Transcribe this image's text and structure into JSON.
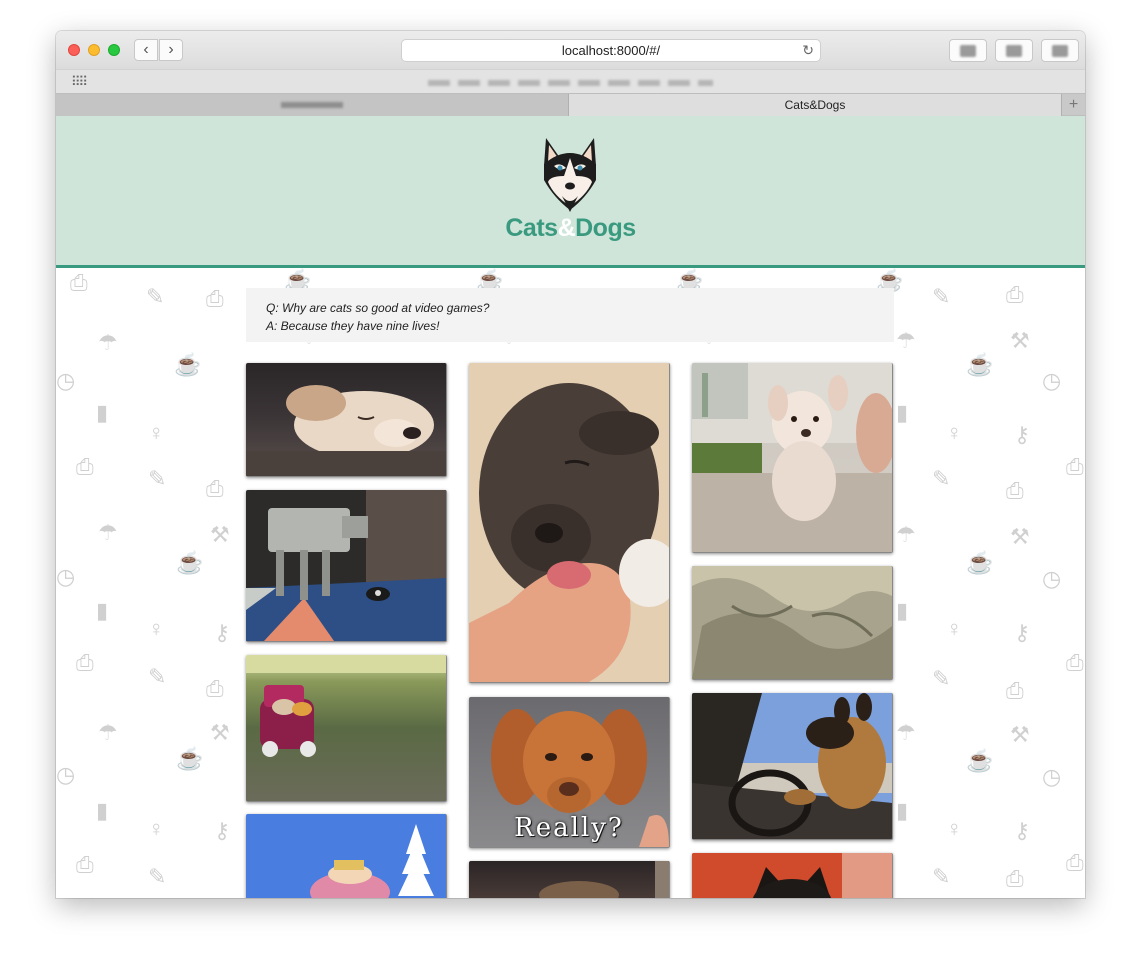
{
  "browser": {
    "url": "localhost:8000/#/",
    "tabs": [
      {
        "label": ""
      },
      {
        "label": "Cats&Dogs"
      }
    ],
    "new_tab_label": "+",
    "back_glyph": "‹",
    "forward_glyph": "›",
    "reload_glyph": "↻",
    "apps_glyph": "⠿⠿"
  },
  "header": {
    "brand_left": "Cats",
    "brand_amp": "&",
    "brand_right": "Dogs",
    "logo": "husky-logo",
    "accent_color": "#3a9a7f",
    "header_bg": "#cfe5da"
  },
  "joke": {
    "question": "Q: Why are cats so good at video games?",
    "answer": "A: Because they have nine lives!"
  },
  "gallery": {
    "columns": [
      [
        {
          "name": "sleeping-puppy-gif"
        },
        {
          "name": "at-at-dog-costume-gif"
        },
        {
          "name": "cats-in-toy-car-gif"
        },
        {
          "name": "blue-cartoon-gif"
        }
      ],
      [
        {
          "name": "dog-licking-hand-gif"
        },
        {
          "name": "really-puppy-gif",
          "caption": "Really?"
        },
        {
          "name": "dark-animal-gif"
        }
      ],
      [
        {
          "name": "flying-puppy-gif"
        },
        {
          "name": "blanket-cat-gif"
        },
        {
          "name": "dog-driving-car-gif"
        },
        {
          "name": "black-cat-gif"
        }
      ]
    ]
  }
}
